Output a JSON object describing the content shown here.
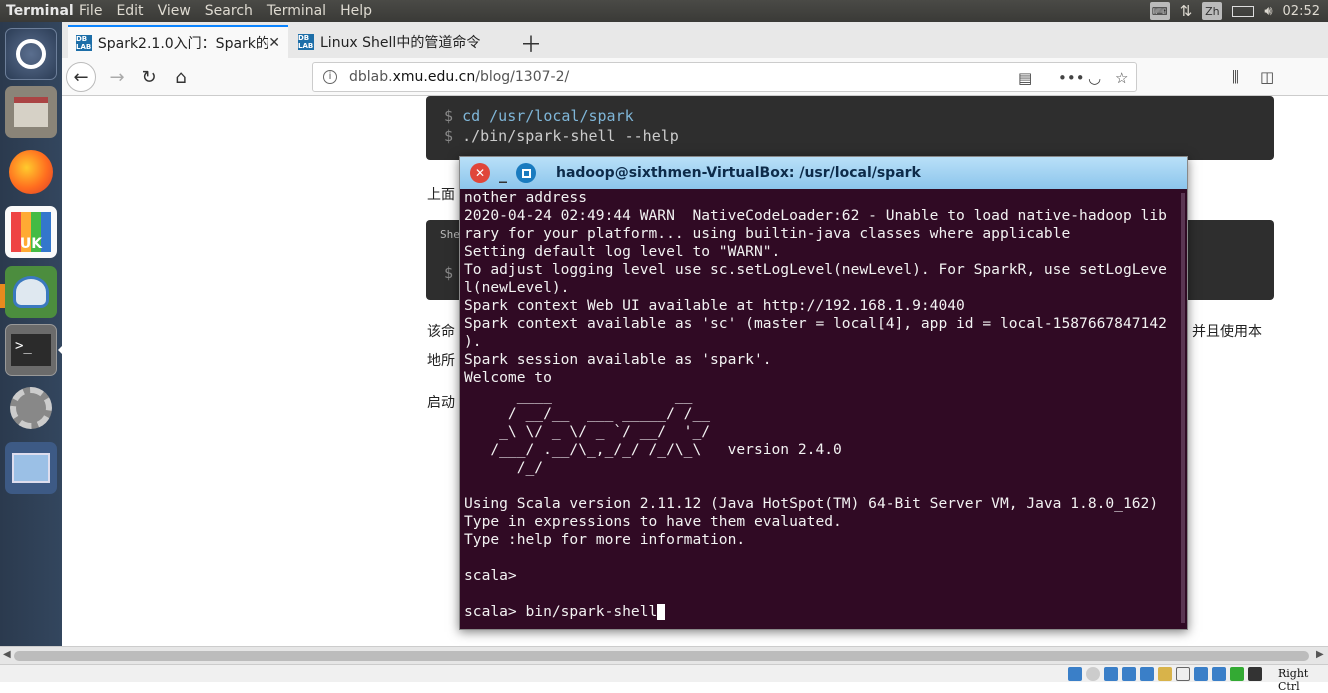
{
  "top_panel": {
    "app_name": "Terminal",
    "menus": [
      "File",
      "Edit",
      "View",
      "Search",
      "Terminal",
      "Help"
    ],
    "keyboard_layout": "Zh",
    "clock": "02:52"
  },
  "launcher": {
    "items": [
      {
        "name": "ubuntu-dash-icon"
      },
      {
        "name": "files-icon"
      },
      {
        "name": "firefox-icon"
      },
      {
        "name": "ubuntu-software-icon",
        "label": "UK"
      },
      {
        "name": "remmina-icon"
      },
      {
        "name": "terminal-icon"
      },
      {
        "name": "system-settings-icon"
      },
      {
        "name": "screenshot-icon"
      }
    ]
  },
  "browser": {
    "tabs": [
      {
        "title": "Spark2.1.0入门：Spark的",
        "favicon": "DB LAB"
      },
      {
        "title": "Linux Shell中的管道命令",
        "favicon": "DB LAB"
      }
    ],
    "url_prefix": "dblab.",
    "url_host": "xmu.edu.cn",
    "url_path": "/blog/1307-2/"
  },
  "page": {
    "code1_line1_prompt": "$",
    "code1_line1_cmd": "cd /usr/local/spark",
    "code1_line2_prompt": "$",
    "code1_line2_cmd": "./bin/spark-shell --help",
    "para1": "上面",
    "shell_label": "She",
    "code2_prompt": "$",
    "para2_start": "该命",
    "para2_end": "并且使用本",
    "para3": "地所",
    "para4": "启动"
  },
  "terminal": {
    "title": "hadoop@sixthmen-VirtualBox: /usr/local/spark",
    "lines": [
      "nother address",
      "2020-04-24 02:49:44 WARN  NativeCodeLoader:62 - Unable to load native-hadoop lib",
      "rary for your platform... using builtin-java classes where applicable",
      "Setting default log level to \"WARN\".",
      "To adjust logging level use sc.setLogLevel(newLevel). For SparkR, use setLogLeve",
      "l(newLevel).",
      "Spark context Web UI available at http://192.168.1.9:4040",
      "Spark context available as 'sc' (master = local[4], app id = local-1587667847142",
      ").",
      "Spark session available as 'spark'.",
      "Welcome to",
      "      ____              __",
      "     / __/__  ___ _____/ /__",
      "    _\\ \\/ _ \\/ _ `/ __/  '_/",
      "   /___/ .__/\\_,_/_/ /_/\\_\\   version 2.4.0",
      "      /_/",
      "",
      "Using Scala version 2.11.12 (Java HotSpot(TM) 64-Bit Server VM, Java 1.8.0_162)",
      "Type in expressions to have them evaluated.",
      "Type :help for more information.",
      "",
      "scala>",
      ""
    ],
    "prompt_line": "scala> bin/spark-shell"
  },
  "vbox": {
    "host_key": "Right Ctrl"
  }
}
